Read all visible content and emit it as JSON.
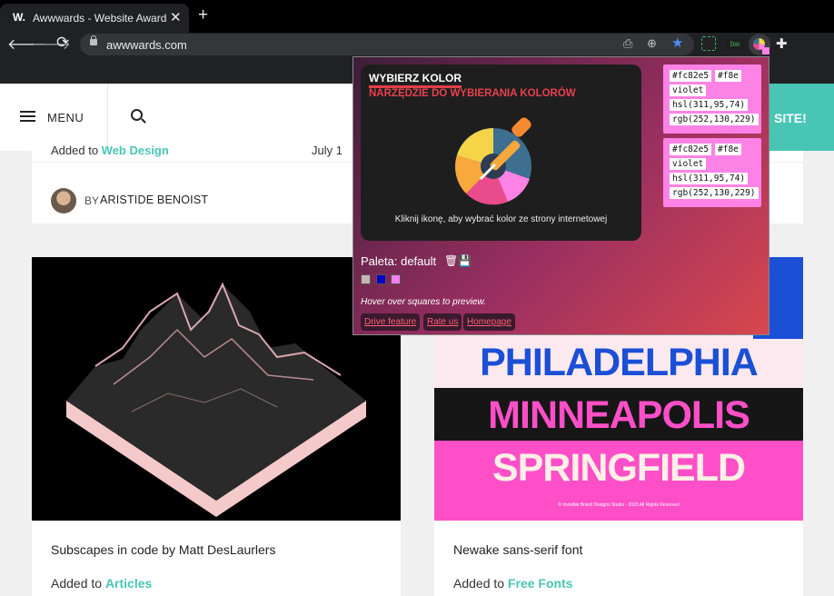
{
  "browser": {
    "tab_favicon": "W.",
    "tab_title": "Awwwards - Website Awards - Be",
    "tab_close": "✕",
    "new_tab": "+",
    "url": "awwwards.com",
    "icons": [
      "arrow-left-icon",
      "arrow-right-icon",
      "reload-icon",
      "lock-icon",
      "install-icon",
      "zoom-icon",
      "star-icon",
      "extension-dashed-icon",
      "extension-bw-icon",
      "color-picker-extension-icon",
      "puzzle-icon"
    ],
    "ext_bw_label": "bw",
    "star_color": "#4d8ff7"
  },
  "site": {
    "menu_label": "MENU",
    "submit_label": "SITE!",
    "accent_color": "#49c5b6",
    "top_card": {
      "added_prefix": "Added to ",
      "added_link": "Web Design",
      "date_partial": "July 1",
      "by_label": "BY",
      "author": "ARISTIDE BENOIST"
    },
    "cards": [
      {
        "title": "Subscapes in code by Matt DesLaurlers",
        "added_prefix": "Added to ",
        "added_link": "Articles"
      },
      {
        "title": "Newake sans-serif font",
        "added_prefix": "Added to ",
        "added_link": "Free Fonts"
      }
    ],
    "font_sample": {
      "lines": [
        "PHILADELPHIA",
        "MINNEAPOLIS",
        "SPRINGFIELD"
      ],
      "footer": "© Invisible Brand Designs Studio · 2020 All Rights Reserved"
    }
  },
  "popup": {
    "title": "WYBIERZ KOLOR",
    "subtitle": "NARZĘDZIE DO WYBIERANIA KOLORÓW",
    "hint": "Kliknij ikonę, aby wybrać kolor ze strony internetowej",
    "color_boxes": [
      {
        "hex": "#fc82e5",
        "short": "#f8e",
        "name": "violet",
        "hsl": "hsl(311,95,74)",
        "rgb": "rgb(252,130,229)"
      },
      {
        "hex": "#fc82e5",
        "short": "#f8e",
        "name": "violet",
        "hsl": "hsl(311,95,74)",
        "rgb": "rgb(252,130,229)"
      }
    ],
    "palette_label": "Paleta: default",
    "palette": [
      "#c9b2b8",
      "#0000c8",
      "#ee82ee"
    ],
    "hover_hint": "Hover over squares to preview.",
    "links": [
      "Drive feature",
      "Rate us",
      "Homepage"
    ]
  }
}
